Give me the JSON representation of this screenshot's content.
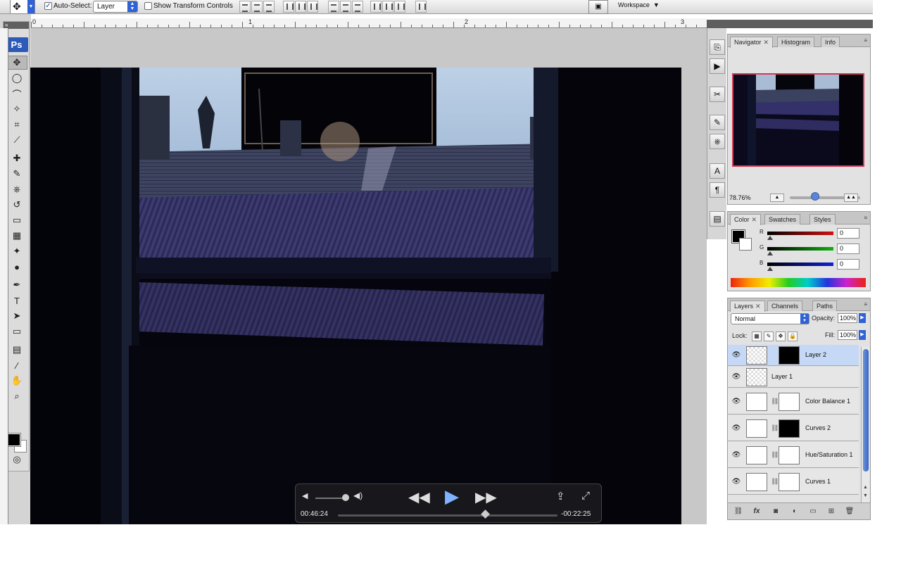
{
  "options_bar": {
    "auto_select_label": "Auto-Select:",
    "auto_select_target": "Layer",
    "transform_controls_label": "Show Transform Controls",
    "workspace_label": "Workspace"
  },
  "toolbox": {
    "logo": "Ps",
    "tools": [
      "move-tool",
      "marquee-tool",
      "lasso-tool",
      "magic-wand-tool",
      "crop-tool",
      "slice-tool",
      "healing-brush-tool",
      "brush-tool",
      "clone-stamp-tool",
      "history-brush-tool",
      "eraser-tool",
      "gradient-tool",
      "blur-tool",
      "dodge-tool",
      "pen-tool",
      "type-tool",
      "path-selection-tool",
      "shape-tool",
      "notes-tool",
      "eyedropper-tool",
      "hand-tool",
      "zoom-tool"
    ]
  },
  "ruler": {
    "labels": [
      "0",
      "1",
      "2",
      "3"
    ]
  },
  "navigator": {
    "tabs": [
      "Navigator",
      "Histogram",
      "Info"
    ],
    "zoom": "78.76%"
  },
  "color_panel": {
    "tabs": [
      "Color",
      "Swatches",
      "Styles"
    ],
    "channels": [
      {
        "label": "R",
        "value": "0",
        "color": "#d01010"
      },
      {
        "label": "G",
        "value": "0",
        "color": "#10b010"
      },
      {
        "label": "B",
        "value": "0",
        "color": "#1020d0"
      }
    ]
  },
  "layers_panel": {
    "tabs": [
      "Layers",
      "Channels",
      "Paths"
    ],
    "blend_mode": "Normal",
    "opacity_label": "Opacity:",
    "opacity_value": "100%",
    "lock_label": "Lock:",
    "fill_label": "Fill:",
    "fill_value": "100%",
    "layers": [
      {
        "name": "Layer 2",
        "selected": true
      },
      {
        "name": "Layer 1",
        "selected": false
      },
      {
        "name": "Color Balance 1",
        "selected": false
      },
      {
        "name": "Curves 2",
        "selected": false
      },
      {
        "name": "Hue/Saturation 1",
        "selected": false
      },
      {
        "name": "Curves 1",
        "selected": false
      }
    ]
  },
  "player": {
    "elapsed": "00:46:24",
    "remaining": "-00:22:25",
    "progress": 0.67
  }
}
